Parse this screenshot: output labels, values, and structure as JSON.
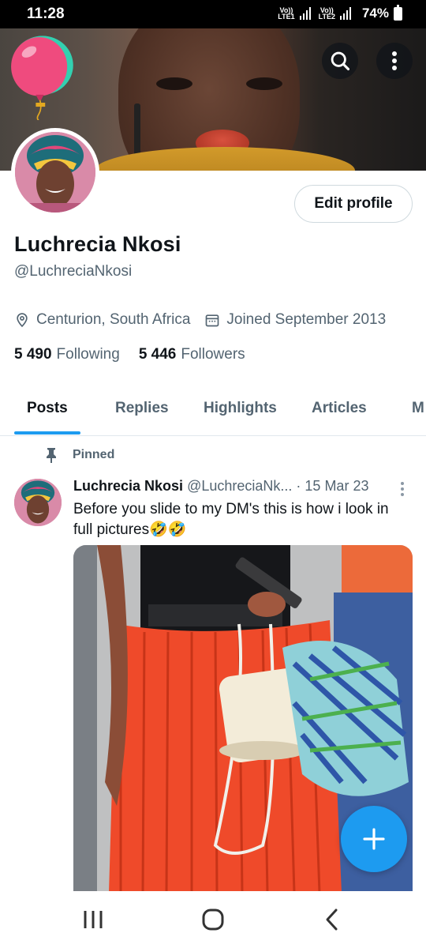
{
  "status_bar": {
    "time": "11:28",
    "network_1": [
      "Vo))",
      "LTE1"
    ],
    "network_2": [
      "Vo))",
      "LTE2"
    ],
    "battery": "74%"
  },
  "profile": {
    "edit_label": "Edit profile",
    "display_name": "Luchrecia  Nkosi",
    "handle": "@LuchreciaNkosi",
    "location": "Centurion, South Africa",
    "joined": "Joined September 2013",
    "following_count": "5 490",
    "following_label": "Following",
    "followers_count": "5 446",
    "followers_label": "Followers"
  },
  "tabs": [
    {
      "label": "Posts",
      "active": true
    },
    {
      "label": "Replies",
      "active": false
    },
    {
      "label": "Highlights",
      "active": false
    },
    {
      "label": "Articles",
      "active": false
    },
    {
      "label": "M",
      "active": false
    }
  ],
  "post": {
    "pinned_label": "Pinned",
    "author_name": "Luchrecia Nkosi",
    "author_handle": "@LuchreciaNk...",
    "date": "· 15 Mar 23",
    "text": "Before you slide  to my DM's this is how i look in full pictures🤣🤣"
  },
  "colors": {
    "accent": "#1d9bf0",
    "text_primary": "#0f1419",
    "text_secondary": "#536471"
  }
}
